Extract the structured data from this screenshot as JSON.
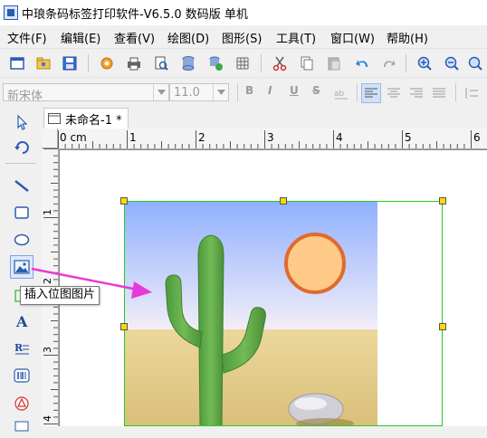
{
  "window": {
    "title": "中琅条码标签打印软件-V6.5.0 数码版 单机"
  },
  "menubar": {
    "items": [
      "文件(F)",
      "编辑(E)",
      "查看(V)",
      "绘图(D)",
      "图形(S)",
      "工具(T)",
      "窗口(W)",
      "帮助(H)"
    ]
  },
  "toolbar": {
    "icons": [
      "new-icon",
      "open-icon",
      "save-icon",
      "settings-icon",
      "print-icon",
      "print-preview-icon",
      "database-icon",
      "database-link-icon",
      "grid-icon",
      "cut-icon",
      "copy-icon",
      "paste-icon",
      "undo-icon",
      "redo-icon",
      "zoom-in-icon",
      "zoom-out-icon",
      "zoom-fit-icon"
    ]
  },
  "format_bar": {
    "font_name": "新宋体",
    "font_size": "11.0",
    "bold": "B",
    "italic": "I",
    "underline": "U",
    "strikethrough": "S"
  },
  "document": {
    "tab_title": "未命名-1 *"
  },
  "ruler": {
    "horizontal_labels": [
      "0 cm",
      "1",
      "2",
      "3",
      "4",
      "5",
      "6"
    ],
    "vertical_labels": [
      "1",
      "2",
      "3",
      "4"
    ]
  },
  "tooltip": {
    "text": "插入位图图片"
  },
  "colors": {
    "accent_arrow": "#e83ad8",
    "selection_border": "#22cc22",
    "handle_fill": "#ffd800",
    "sky_top": "#8fb0ff",
    "sand": "#e4cd8b",
    "cactus": "#5fa84a",
    "sun_fill": "#ffc987",
    "sun_stroke": "#e06a2e"
  }
}
